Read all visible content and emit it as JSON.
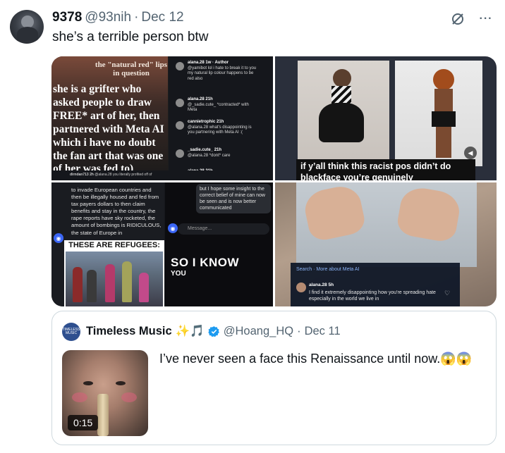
{
  "tweet": {
    "author_name": "9378",
    "author_handle": "@93nih",
    "separator": "·",
    "date": "Dec 12",
    "text": "she’s a terrible person btw",
    "more_label": "···"
  },
  "media": {
    "tile1": {
      "caption": "the \"natural red\" lips in question",
      "meme_text": "she is a grifter who asked people to draw FREE* art of her, then partnered with Meta AI which i have no doubt the fan art that was one of her was fed to)",
      "comments": [
        {
          "user": "alana.28 1w · Author",
          "text": "@yamibot lol i hate to break it to you my natural lip colour happens to be red also"
        },
        {
          "user": "alana.28 21h",
          "text": "@_sadie.cute_ *contracted* with Meta"
        },
        {
          "user": "cannietrophic 21h",
          "text": "@alana.28 what's disappointing is you partnering with Meta AI :("
        },
        {
          "user": "_sadie.cute_ 21h",
          "text": "@alana.28 *dont* care"
        },
        {
          "user": "alana.28 21h",
          "text": ""
        }
      ],
      "bottom_user": "dirndan713 2h",
      "bottom_text": "@alana.28 you literally profited off of"
    },
    "tile2": {
      "subtitle": "if y’all think this racist pos didn’t do blackface you’re genuinely"
    },
    "tile3": {
      "article": "to invade European countries and then be illegally housed and fed from tax payers dollars to then claim benefits and stay in the country, the rape reports have sky rocketed, the amount of bombings is RIDICULOUS, the state of Europe in",
      "refugee_title": "THESE ARE REFUGEES:",
      "bubble": "but I hope some insight to the correct belief of mine can now be seen and is now better communicated",
      "message_placeholder": "Message...",
      "overlay_line1": "SO I KNOW",
      "overlay_line2": "YOU"
    },
    "tile4": {
      "search_label": "Search · More about Meta AI",
      "commenter": "alana.28 5h",
      "comment": "I find it extremely disappointing how you're spreading hate especially in the world we live in"
    }
  },
  "quote": {
    "avatar_text": "TIMELESS MUSIC",
    "name": "Timeless Music",
    "emojis": "✨🎵",
    "handle": "@Hoang_HQ",
    "separator": "·",
    "date": "Dec 11",
    "text": "I’ve never seen a face this Renaissance until now.😱😱",
    "duration": "0:15"
  },
  "colors": {
    "muted": "#536471",
    "verified_blue": "#1d9bf0",
    "border": "#cfd9de"
  }
}
